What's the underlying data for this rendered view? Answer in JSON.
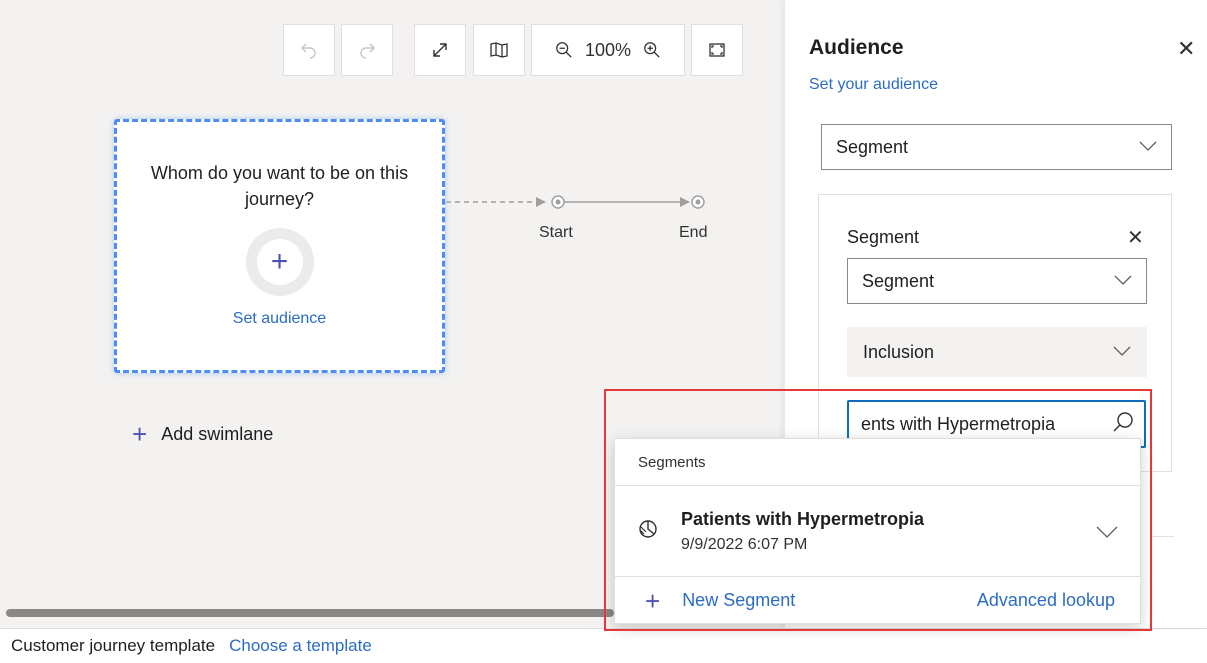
{
  "toolbar": {
    "undo_icon": "undo-icon",
    "redo_icon": "redo-icon",
    "expand_icon": "expand-icon",
    "map_icon": "map-icon",
    "zoom_level": "100%",
    "fit_icon": "fit-to-screen-icon"
  },
  "canvas": {
    "card_question": "Whom do you want to be on this journey?",
    "set_audience_label": "Set audience",
    "start_label": "Start",
    "end_label": "End",
    "add_swimlane_label": "Add swimlane"
  },
  "footer": {
    "label": "Customer journey template",
    "link": "Choose a template"
  },
  "panel": {
    "title": "Audience",
    "subtitle": "Set your audience",
    "type_select": "Segment",
    "segment_box": {
      "title": "Segment",
      "segment_select": "Segment",
      "inclusion_select": "Inclusion",
      "search_value": "ents with Hypermetropia"
    }
  },
  "popup": {
    "header": "Segments",
    "items": [
      {
        "name": "Patients with Hypermetropia",
        "date": "9/9/2022 6:07 PM",
        "icon": "segment-icon"
      }
    ],
    "new_segment_label": "New Segment",
    "advanced_lookup_label": "Advanced lookup"
  },
  "colors": {
    "accent_blue": "#2b6cc4",
    "highlight_red": "#e5383b",
    "plus_purple": "#4f52b2"
  }
}
